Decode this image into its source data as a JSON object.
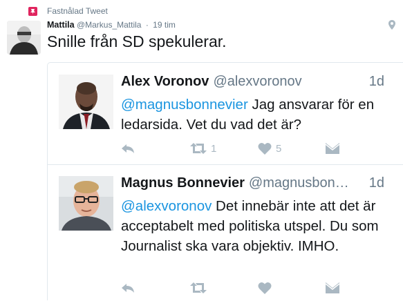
{
  "pinned_label": "Fastnålad Tweet",
  "tweet": {
    "author_name": "Mattila",
    "author_handle": "@Markus_Mattila",
    "separator": "·",
    "time": "19 tim",
    "text": "Snille från SD spekulerar."
  },
  "quoted": [
    {
      "author_name": "Alex Voronov",
      "author_handle": "@alexvoronov",
      "time": "1d",
      "mention": "@magnusbonnevier",
      "text": " Jag ansvarar för en ledarsida. Vet du vad det är?",
      "retweet_count": "1",
      "like_count": "5"
    },
    {
      "author_name": "Magnus Bonnevier",
      "author_handle": "@magnusbon…",
      "time": "1d",
      "mention": "@alexvoronov",
      "text": " Det innebär inte att det är acceptabelt med politiska utspel. Du som Journalist ska vara objektiv. IMHO.",
      "retweet_count": "",
      "like_count": ""
    }
  ],
  "colors": {
    "link": "#1b95e0",
    "muted": "#657786",
    "action_icon": "#aab8c2",
    "pin": "#e0245e"
  },
  "icons": {
    "pin": "pin-icon",
    "geo": "location-pin-icon",
    "reply": "reply-icon",
    "retweet": "retweet-icon",
    "like": "heart-icon",
    "dm": "direct-message-icon"
  }
}
